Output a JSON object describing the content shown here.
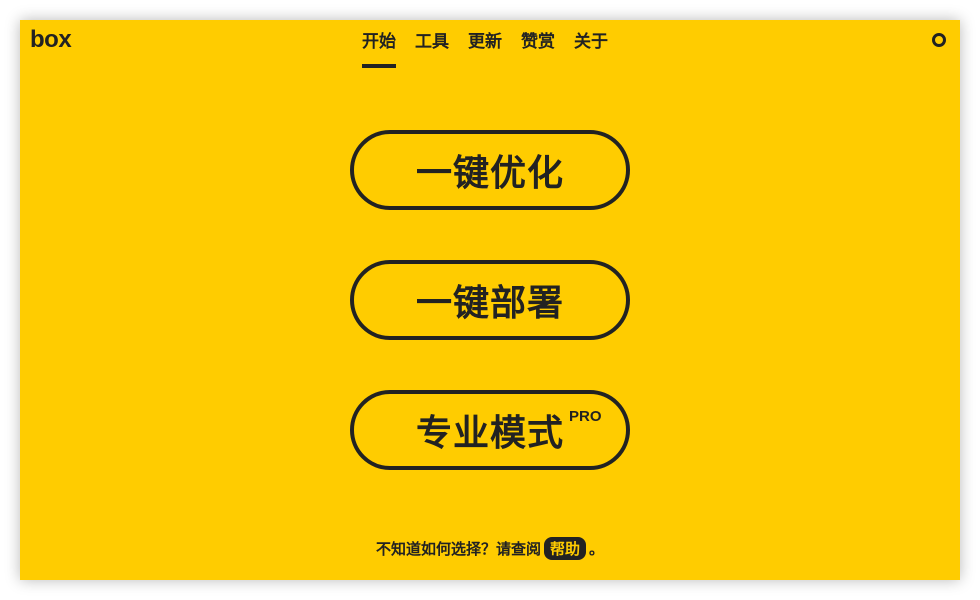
{
  "app": {
    "logo": "box"
  },
  "nav": {
    "tabs": [
      {
        "label": "开始",
        "active": true
      },
      {
        "label": "工具",
        "active": false
      },
      {
        "label": "更新",
        "active": false
      },
      {
        "label": "赞赏",
        "active": false
      },
      {
        "label": "关于",
        "active": false
      }
    ]
  },
  "header": {
    "status_icon": "ring-icon"
  },
  "actions": {
    "one_click_optimize": "一键优化",
    "one_click_deploy": "一键部署",
    "pro_mode": "专业模式",
    "pro_badge": "PRO"
  },
  "footer": {
    "prompt": "不知道如何选择？请查阅",
    "help_link": "帮助",
    "end": "。"
  },
  "colors": {
    "background": "#ffcc00",
    "foreground": "#222222"
  }
}
